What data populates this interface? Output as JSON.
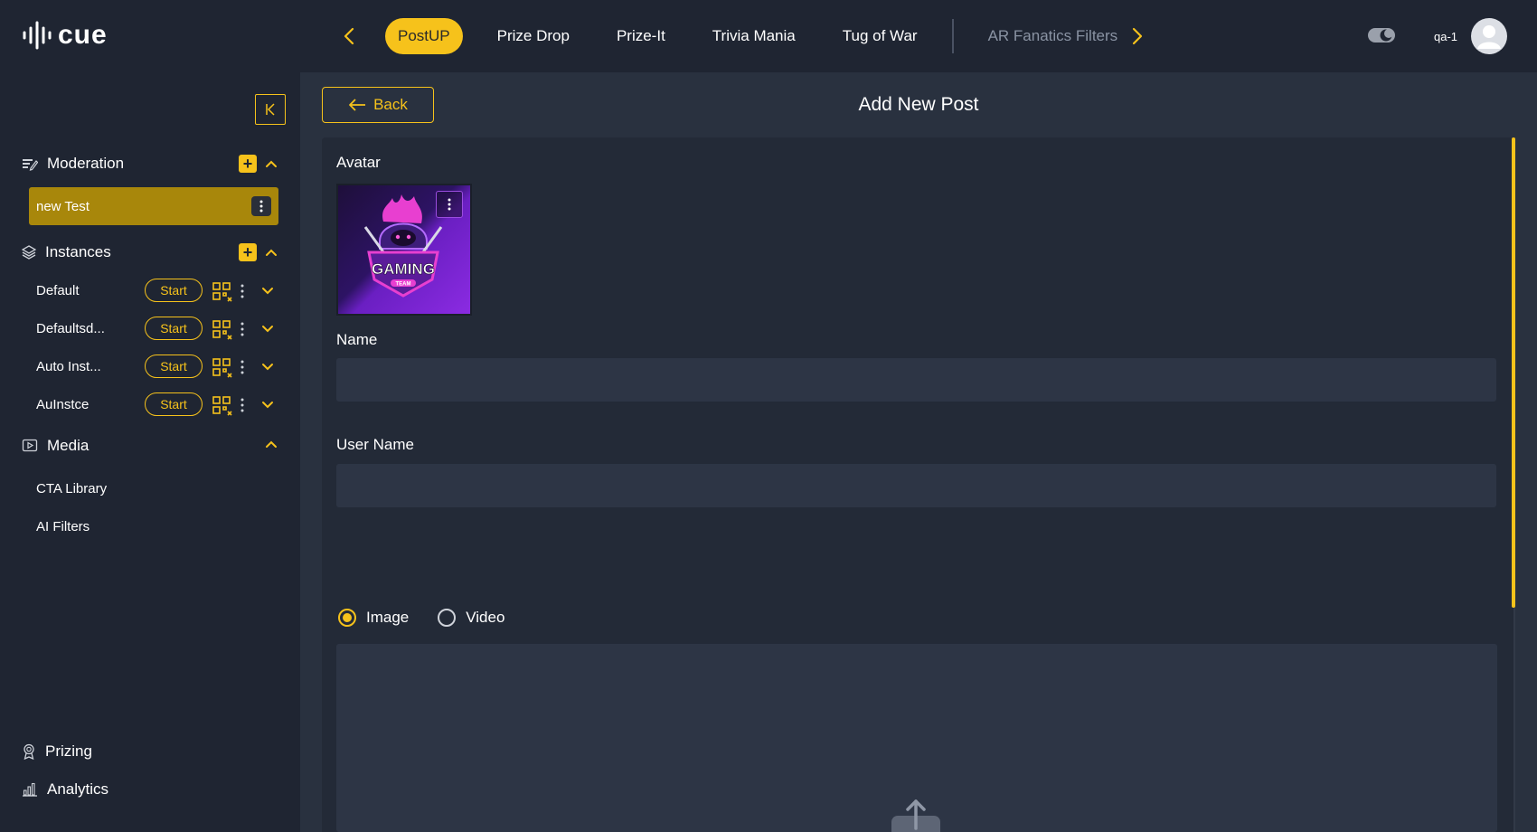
{
  "app": {
    "logo_text": "cue",
    "user_name": "qa-1"
  },
  "tabs": [
    {
      "label": "PostUP",
      "active": true
    },
    {
      "label": "Prize Drop",
      "active": false
    },
    {
      "label": "Prize-It",
      "active": false
    },
    {
      "label": "Trivia Mania",
      "active": false
    },
    {
      "label": "Tug of War",
      "active": false
    },
    {
      "label": "AR Fanatics Filters",
      "active": false,
      "dimmed": true
    }
  ],
  "sidebar": {
    "moderation": {
      "label": "Moderation",
      "items": [
        {
          "label": "new Test"
        }
      ]
    },
    "instances": {
      "label": "Instances",
      "start_label": "Start",
      "items": [
        {
          "label": "Default"
        },
        {
          "label": "Defaultsd..."
        },
        {
          "label": "Auto Inst..."
        },
        {
          "label": "AuInstce"
        }
      ]
    },
    "media": {
      "label": "Media",
      "items": [
        {
          "label": "CTA Library"
        },
        {
          "label": "AI Filters"
        }
      ]
    },
    "prizing_label": "Prizing",
    "analytics_label": "Analytics"
  },
  "main": {
    "back_label": "Back",
    "title": "Add New Post",
    "form": {
      "avatar_label": "Avatar",
      "avatar_image_text": {
        "line1": "GAMING",
        "line2": "TEAM"
      },
      "name_label": "Name",
      "name_value": "",
      "username_label": "User Name",
      "username_value": "",
      "media_type": {
        "options": [
          "Image",
          "Video"
        ],
        "selected": "Image"
      }
    }
  },
  "colors": {
    "accent": "#f6c21b",
    "sidebar_bg": "#1f2532",
    "main_bg": "#29313f",
    "panel_bg": "#232a37",
    "input_bg": "#2d3545",
    "active_item": "#a8870b"
  },
  "icons": {
    "logo": "audio-wave-logo-icon",
    "theme": "moon-toggle-icon",
    "avatar": "user-avatar-icon",
    "collapse": "collapse-sidebar-icon",
    "upload": "upload-icon"
  }
}
